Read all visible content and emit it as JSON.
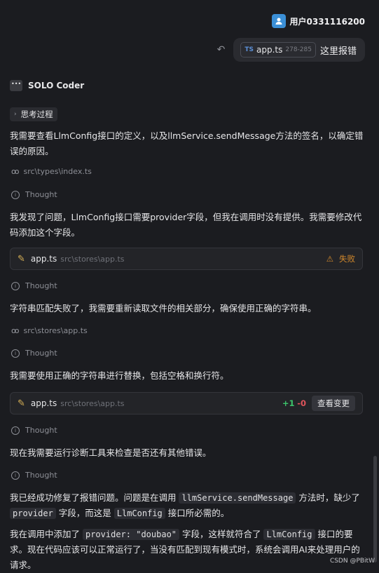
{
  "user": {
    "name": "用户0331116200",
    "avatar_icon": "person-avatar"
  },
  "user_message": {
    "undo_icon": "undo-icon",
    "file": {
      "badge": "TS",
      "name": "app.ts",
      "range": "278-285"
    },
    "text": "这里报错"
  },
  "assistant": {
    "name": "SOLO Coder"
  },
  "think_toggle": "思考过程",
  "steps": {
    "p1": "我需要查看LlmConfig接口的定义，以及llmService.sendMessage方法的签名，以确定错误的原因。",
    "read1_path": "src\\types\\index.ts",
    "thought_label": "Thought",
    "p2": "我发现了问题，LlmConfig接口需要provider字段，但我在调用时没有提供。我需要修改代码添加这个字段。",
    "card1": {
      "file": "app.ts",
      "path": "src\\stores\\app.ts",
      "status": "失败"
    },
    "p3": "字符串匹配失败了，我需要重新读取文件的相关部分，确保使用正确的字符串。",
    "read2_path": "src\\stores\\app.ts",
    "p4": "我需要使用正确的字符串进行替换，包括空格和换行符。",
    "card2": {
      "file": "app.ts",
      "path": "src\\stores\\app.ts",
      "added": "+1",
      "removed": "-0",
      "button": "查看变更"
    },
    "p5": "现在我需要运行诊断工具来检查是否还有其他错误。",
    "final1": {
      "a": "我已经成功修复了报错问题。问题是在调用 ",
      "code1": "llmService.sendMessage",
      "b": " 方法时，缺少了 ",
      "code2": "provider",
      "c": " 字段，而这是 ",
      "code3": "LlmConfig",
      "d": " 接口所必需的。"
    },
    "final2": {
      "a": "我在调用中添加了 ",
      "code1": "provider: \"doubao\"",
      "b": " 字段，这样就符合了 ",
      "code2": "LlmConfig",
      "c": " 接口的要求。现在代码应该可以正常运行了，当没有匹配到现有模式时，系统会调用AI来处理用户的请求。"
    }
  },
  "watermark": "CSDN @PBitW"
}
